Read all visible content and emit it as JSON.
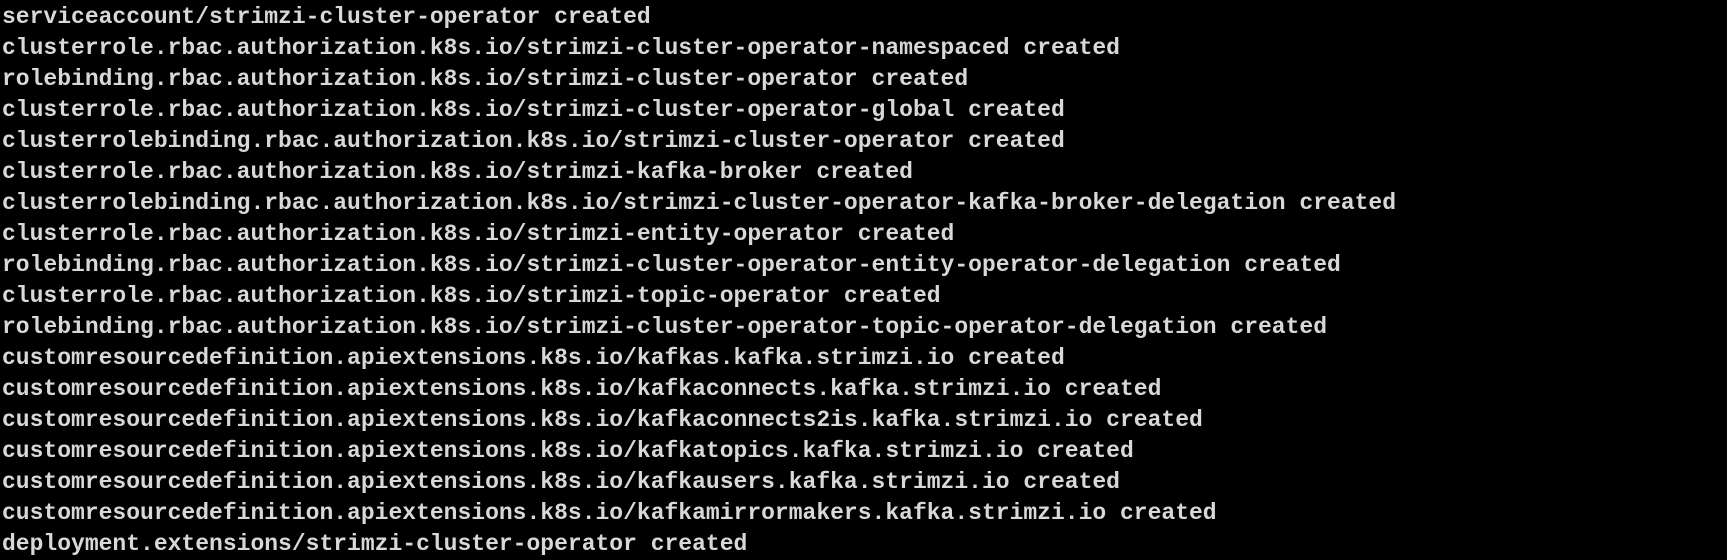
{
  "terminal": {
    "text_color": "#d8d8d8",
    "background_color": "#000000",
    "lines": [
      "serviceaccount/strimzi-cluster-operator created",
      "clusterrole.rbac.authorization.k8s.io/strimzi-cluster-operator-namespaced created",
      "rolebinding.rbac.authorization.k8s.io/strimzi-cluster-operator created",
      "clusterrole.rbac.authorization.k8s.io/strimzi-cluster-operator-global created",
      "clusterrolebinding.rbac.authorization.k8s.io/strimzi-cluster-operator created",
      "clusterrole.rbac.authorization.k8s.io/strimzi-kafka-broker created",
      "clusterrolebinding.rbac.authorization.k8s.io/strimzi-cluster-operator-kafka-broker-delegation created",
      "clusterrole.rbac.authorization.k8s.io/strimzi-entity-operator created",
      "rolebinding.rbac.authorization.k8s.io/strimzi-cluster-operator-entity-operator-delegation created",
      "clusterrole.rbac.authorization.k8s.io/strimzi-topic-operator created",
      "rolebinding.rbac.authorization.k8s.io/strimzi-cluster-operator-topic-operator-delegation created",
      "customresourcedefinition.apiextensions.k8s.io/kafkas.kafka.strimzi.io created",
      "customresourcedefinition.apiextensions.k8s.io/kafkaconnects.kafka.strimzi.io created",
      "customresourcedefinition.apiextensions.k8s.io/kafkaconnects2is.kafka.strimzi.io created",
      "customresourcedefinition.apiextensions.k8s.io/kafkatopics.kafka.strimzi.io created",
      "customresourcedefinition.apiextensions.k8s.io/kafkausers.kafka.strimzi.io created",
      "customresourcedefinition.apiextensions.k8s.io/kafkamirrormakers.kafka.strimzi.io created",
      "deployment.extensions/strimzi-cluster-operator created"
    ]
  }
}
